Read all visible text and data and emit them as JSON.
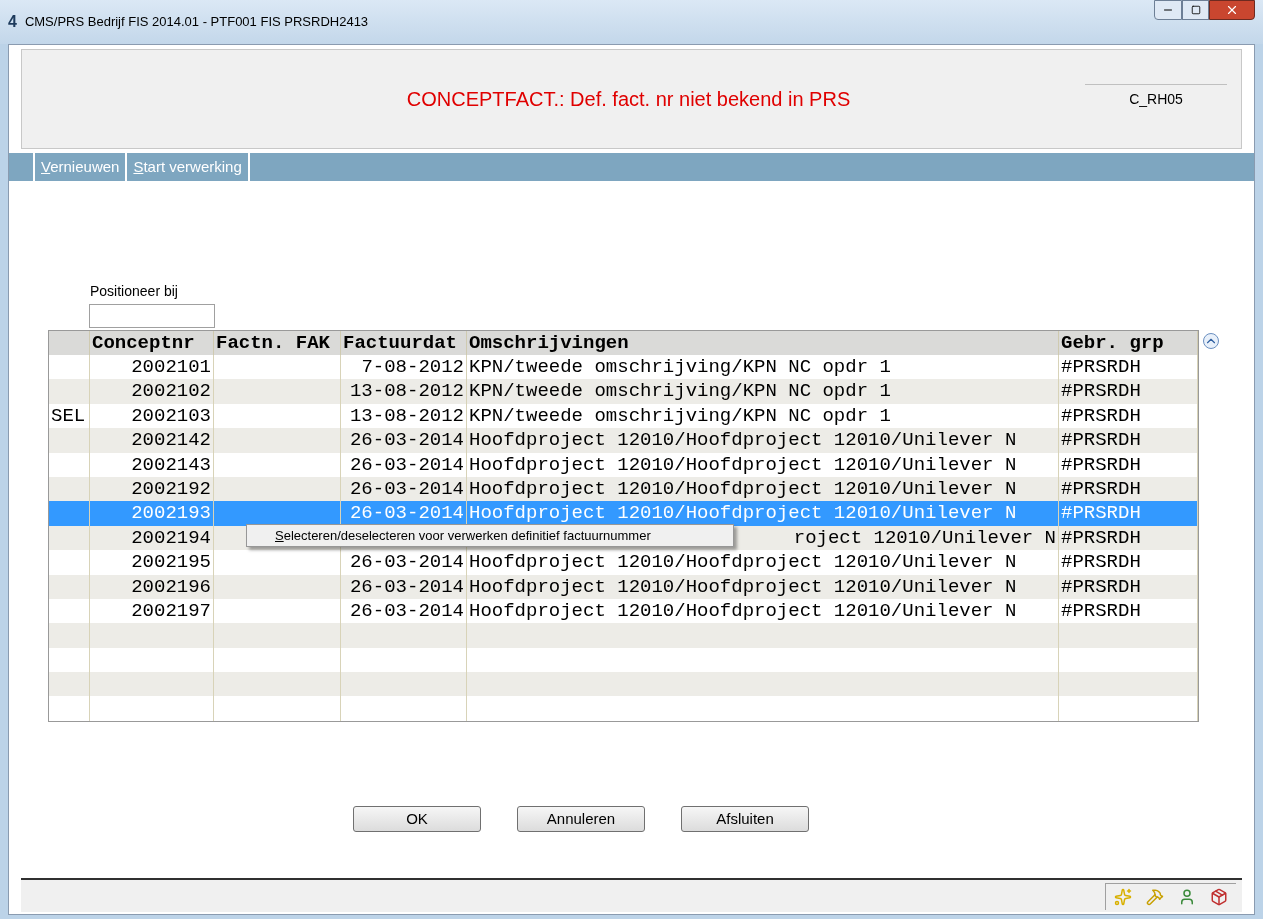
{
  "window": {
    "app_icon": "4",
    "title": "CMS/PRS  Bedrijf FIS 2014.01  - PTF001 FIS PRSRDH2413"
  },
  "header": {
    "title": "CONCEPTFACT.: Def. fact. nr niet bekend in PRS",
    "code": "C_RH05"
  },
  "menu": [
    {
      "label": "Vernieuwen"
    },
    {
      "label": "Start verwerking"
    }
  ],
  "position_field": {
    "label": "Positioneer bij"
  },
  "table": {
    "columns": [
      "",
      "Conceptnr",
      "Factn. FAK",
      "Factuurdat",
      "Omschrijvingen",
      "Gebr. grp"
    ],
    "rows": [
      {
        "sel": "",
        "conceptnr": "2002101",
        "factn": "",
        "date": "7-08-2012",
        "description": "KPN/tweede omschrijving/KPN NC opdr 1",
        "group": "#PRSRDH",
        "selected": false
      },
      {
        "sel": "",
        "conceptnr": "2002102",
        "factn": "",
        "date": "13-08-2012",
        "description": "KPN/tweede omschrijving/KPN NC opdr 1",
        "group": "#PRSRDH",
        "selected": false
      },
      {
        "sel": "SEL",
        "conceptnr": "2002103",
        "factn": "",
        "date": "13-08-2012",
        "description": "KPN/tweede omschrijving/KPN NC opdr 1",
        "group": "#PRSRDH",
        "selected": false
      },
      {
        "sel": "",
        "conceptnr": "2002142",
        "factn": "",
        "date": "26-03-2014",
        "description": "Hoofdproject 12010/Hoofdproject 12010/Unilever N",
        "group": "#PRSRDH",
        "selected": false
      },
      {
        "sel": "",
        "conceptnr": "2002143",
        "factn": "",
        "date": "26-03-2014",
        "description": "Hoofdproject 12010/Hoofdproject 12010/Unilever N",
        "group": "#PRSRDH",
        "selected": false
      },
      {
        "sel": "",
        "conceptnr": "2002192",
        "factn": "",
        "date": "26-03-2014",
        "description": "Hoofdproject 12010/Hoofdproject 12010/Unilever N",
        "group": "#PRSRDH",
        "selected": false
      },
      {
        "sel": "",
        "conceptnr": "2002193",
        "factn": "",
        "date": "26-03-2014",
        "description": "Hoofdproject 12010/Hoofdproject 12010/Unilever N",
        "group": "#PRSRDH",
        "selected": true
      },
      {
        "sel": "",
        "conceptnr": "2002194",
        "factn": "",
        "description": "roject 12010/Unilever N",
        "group": "#PRSRDH",
        "selected": false
      },
      {
        "sel": "",
        "conceptnr": "2002195",
        "factn": "",
        "date": "26-03-2014",
        "description": "Hoofdproject 12010/Hoofdproject 12010/Unilever N",
        "group": "#PRSRDH",
        "selected": false
      },
      {
        "sel": "",
        "conceptnr": "2002196",
        "factn": "",
        "date": "26-03-2014",
        "description": "Hoofdproject 12010/Hoofdproject 12010/Unilever N",
        "group": "#PRSRDH",
        "selected": false
      },
      {
        "sel": "",
        "conceptnr": "2002197",
        "factn": "",
        "date": "26-03-2014",
        "description": "Hoofdproject 12010/Hoofdproject 12010/Unilever N",
        "group": "#PRSRDH",
        "selected": false
      }
    ]
  },
  "context_menu": {
    "item": "Selecteren/deselecteren voor verwerken definitief factuurnummer"
  },
  "buttons": [
    "OK",
    "Annuleren",
    "Afsluiten"
  ]
}
